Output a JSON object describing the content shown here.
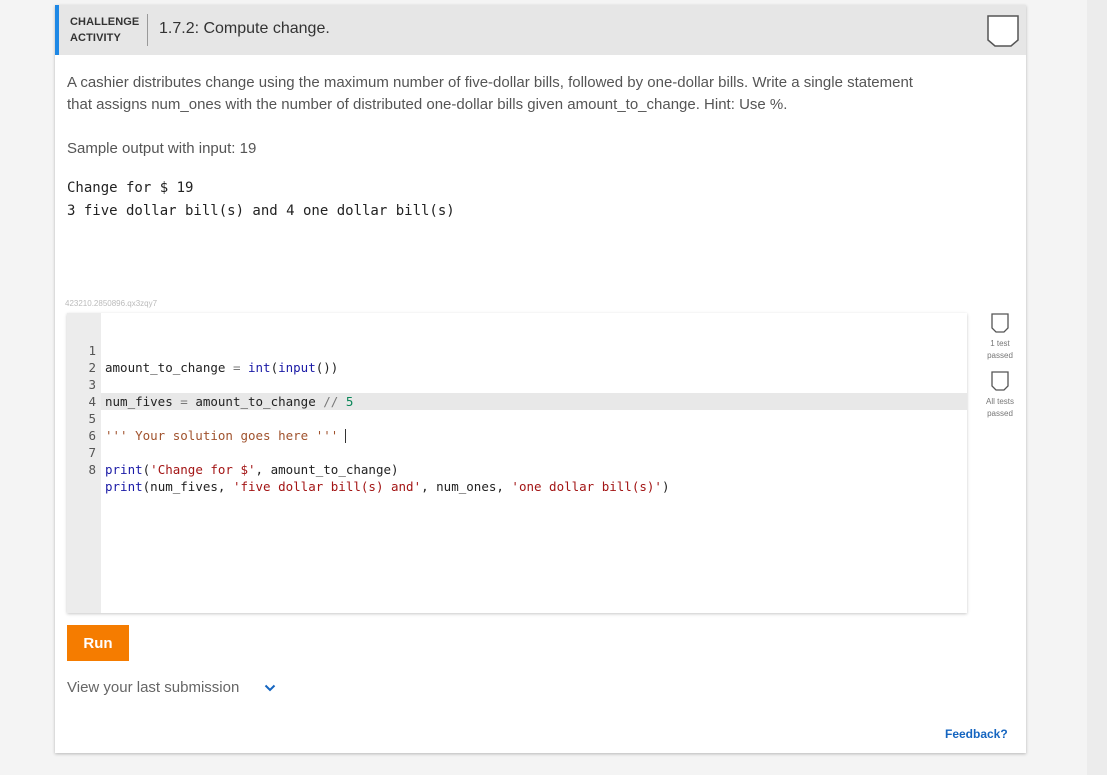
{
  "header": {
    "badge_line1": "CHALLENGE",
    "badge_line2": "ACTIVITY",
    "title": "1.7.2: Compute change."
  },
  "prompt": {
    "line1": "A cashier distributes change using the maximum number of five-dollar bills, followed by one-dollar bills. Write a single statement",
    "line2": "that assigns num_ones with the number of distributed one-dollar bills given amount_to_change. Hint: Use %."
  },
  "sample": {
    "label": "Sample output with input: 19",
    "output_lines": [
      "Change for $ 19",
      "3 five dollar bill(s) and 4 one dollar bill(s)"
    ]
  },
  "activity_id": "423210.2850896.qx3zqy7",
  "editor": {
    "line_numbers": [
      "1",
      "2",
      "3",
      "4",
      "5",
      "6",
      "7",
      "8"
    ],
    "l1": {
      "a": "amount_to_change",
      "b": " = ",
      "c": "int",
      "d": "(",
      "e": "input",
      "f": "())"
    },
    "l3": {
      "a": "num_fives",
      "b": " = ",
      "c": "amount_to_change",
      "d": " // ",
      "e": "5"
    },
    "l5": "''' Your solution goes here '''",
    "l7": {
      "a": "print",
      "b": "(",
      "c": "'Change for $'",
      "d": ", amount_to_change)"
    },
    "l8": {
      "a": "print",
      "b": "(num_fives, ",
      "c": "'five dollar bill(s) and'",
      "d": ", num_ones, ",
      "e": "'one dollar bill(s)'",
      "f": ")"
    }
  },
  "tests": {
    "one_test": "1 test",
    "one_test_status": "passed",
    "all_tests": "All tests",
    "all_tests_status": "passed"
  },
  "run_label": "Run",
  "last_submission_label": "View your last submission",
  "feedback_label": "Feedback?",
  "colors": {
    "accent": "#1e88e5",
    "run_button": "#f57c00",
    "feedback": "#1565c0"
  }
}
